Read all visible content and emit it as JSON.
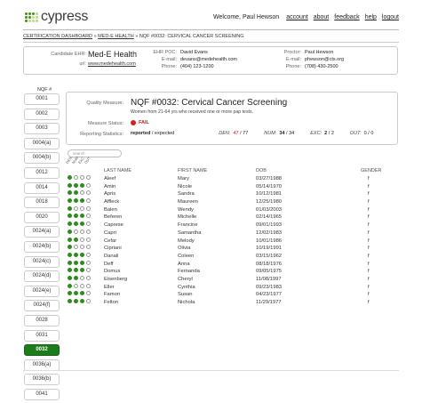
{
  "app": {
    "name": "cypress"
  },
  "topnav": {
    "welcome": "Welcome, Paul Hewson",
    "links": [
      "account",
      "about",
      "feedback",
      "help",
      "logout"
    ]
  },
  "breadcrumb": [
    "CERTIFICATION DASHBOARD",
    "MED-E HEALTH",
    "NQF #0032: CERVICAL CANCER SCREENING"
  ],
  "breadcrumb_sep": "»",
  "candidate": {
    "label": "Candidate EHR:",
    "name": "Med-E Health",
    "url_label": "url:",
    "url": "www.medehealth.com",
    "poc_label": "EHR POC:",
    "poc": "David Evans",
    "email_label": "E-mail:",
    "email": "devans@medehealth.com",
    "phone_label": "Phone:",
    "phone": "(404) 123-1200"
  },
  "proctor": {
    "label": "Proctor:",
    "name": "Paul Hewson",
    "email_label": "E-mail:",
    "email": "phewson@cts.org",
    "phone_label": "Phone:",
    "phone": "(708) 430-2500"
  },
  "nqf": {
    "header": "NQF #",
    "items": [
      "0001",
      "0002",
      "0003",
      "0004(a)",
      "0004(b)",
      "0012",
      "0014",
      "0018",
      "0020",
      "0024(a)",
      "0024(b)",
      "0024(c)",
      "0024(d)",
      "0024(e)",
      "0024(f)",
      "0028",
      "0031",
      "0032",
      "0036(a)",
      "0036(b)",
      "0041"
    ],
    "selected": "0032"
  },
  "measure": {
    "qm_label": "Quality Measure:",
    "title": "NQF #0032: Cervical Cancer Screening",
    "description": "Women from 21-64 yrs who received one or more pap tests.",
    "status_label": "Measure Status:",
    "status": "FAIL",
    "stats_label": "Reporting Statistics:",
    "reported": "reported",
    "expected": "expected",
    "den_label": "DEN:",
    "den": "47",
    "den_total": "77",
    "num_label": "NUM:",
    "num": "34",
    "num_total": "34",
    "exc_label": "EXC:",
    "exc": "2",
    "exc_total": "2",
    "out_label": "OUT:",
    "out": "0",
    "out_total": "0"
  },
  "table": {
    "search_placeholder": "search",
    "flag_headers": [
      "DEN",
      "NUM",
      "EXC",
      "OUT"
    ],
    "headers": [
      "LAST NAME",
      "FIRST NAME",
      "DOB",
      "GENDER"
    ],
    "rows": [
      {
        "last": "Aleef",
        "first": "Mary",
        "dob": "03/27/1988",
        "gender": "f",
        "flags": [
          1,
          0,
          0,
          0
        ]
      },
      {
        "last": "Amin",
        "first": "Nicole",
        "dob": "05/14/1970",
        "gender": "f",
        "flags": [
          1,
          1,
          1,
          0
        ]
      },
      {
        "last": "Apris",
        "first": "Sandra",
        "dob": "10/12/1981",
        "gender": "f",
        "flags": [
          1,
          1,
          0,
          0
        ]
      },
      {
        "last": "Affleck",
        "first": "Maureen",
        "dob": "12/25/1980",
        "gender": "f",
        "flags": [
          1,
          1,
          1,
          0
        ]
      },
      {
        "last": "Balen",
        "first": "Wendy",
        "dob": "01/03/2003",
        "gender": "f",
        "flags": [
          1,
          0,
          0,
          0
        ]
      },
      {
        "last": "Beferen",
        "first": "Michelle",
        "dob": "02/14/1965",
        "gender": "f",
        "flags": [
          1,
          1,
          1,
          0
        ]
      },
      {
        "last": "Caprese",
        "first": "Francine",
        "dob": "09/01/1993",
        "gender": "f",
        "flags": [
          1,
          1,
          1,
          0
        ]
      },
      {
        "last": "Capri",
        "first": "Samantha",
        "dob": "12/02/1983",
        "gender": "f",
        "flags": [
          1,
          0,
          0,
          0
        ]
      },
      {
        "last": "Cefar",
        "first": "Melody",
        "dob": "10/01/1986",
        "gender": "f",
        "flags": [
          1,
          1,
          0,
          0
        ]
      },
      {
        "last": "Cipriani",
        "first": "Olivia",
        "dob": "10/19/1991",
        "gender": "f",
        "flags": [
          1,
          0,
          0,
          0
        ]
      },
      {
        "last": "Danali",
        "first": "Coleen",
        "dob": "03/15/1962",
        "gender": "f",
        "flags": [
          1,
          1,
          1,
          0
        ]
      },
      {
        "last": "Deff",
        "first": "Anna",
        "dob": "08/18/1976",
        "gender": "f",
        "flags": [
          1,
          1,
          1,
          0
        ]
      },
      {
        "last": "Domus",
        "first": "Fernanda",
        "dob": "09/05/1975",
        "gender": "f",
        "flags": [
          1,
          1,
          1,
          0
        ]
      },
      {
        "last": "Eisenberg",
        "first": "Cheryl",
        "dob": "11/08/1997",
        "gender": "f",
        "flags": [
          1,
          1,
          0,
          0
        ]
      },
      {
        "last": "Eller",
        "first": "Cynthia",
        "dob": "09/23/1983",
        "gender": "f",
        "flags": [
          1,
          0,
          0,
          0
        ]
      },
      {
        "last": "Famon",
        "first": "Susan",
        "dob": "04/23/1977",
        "gender": "f",
        "flags": [
          1,
          1,
          1,
          0
        ]
      },
      {
        "last": "Felton",
        "first": "Nichola",
        "dob": "11/29/1977",
        "gender": "f",
        "flags": [
          1,
          1,
          1,
          0
        ]
      }
    ]
  }
}
